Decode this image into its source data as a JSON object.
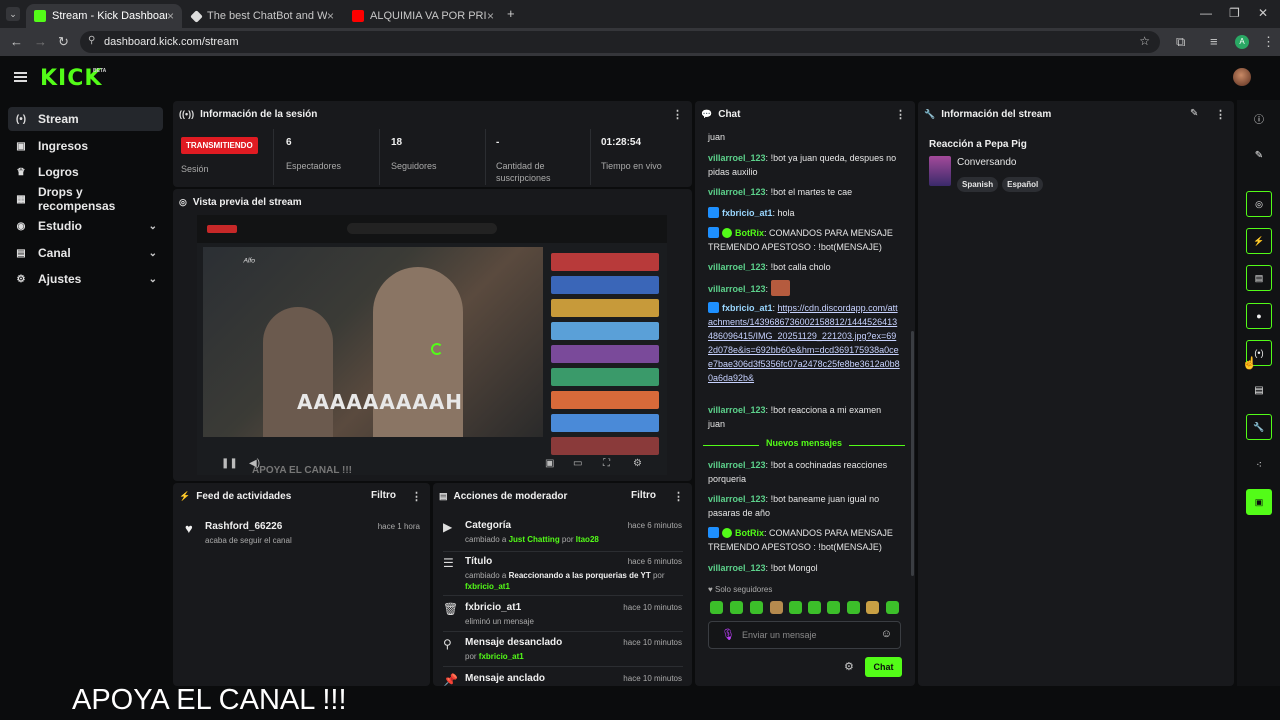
{
  "browser": {
    "tabs": [
      {
        "label": "Stream - Kick Dashboard",
        "active": true,
        "favicon_color": "#53fc18"
      },
      {
        "label": "The best ChatBot and Widgets",
        "active": false,
        "favicon_color": "#dddddd"
      },
      {
        "label": "ALQUIMIA VA POR PRIMERA V",
        "active": false,
        "favicon_color": "#ff0000"
      }
    ],
    "new_tab": "+",
    "url": "dashboard.kick.com/stream",
    "profile_initial": "A"
  },
  "header": {
    "logo": "KICK",
    "beta": "BETA"
  },
  "sidebar": {
    "items": [
      {
        "label": "Stream",
        "icon": "broadcast-icon",
        "glyph": "(•)",
        "active": true
      },
      {
        "label": "Ingresos",
        "icon": "money-icon",
        "glyph": "▣",
        "active": false
      },
      {
        "label": "Logros",
        "icon": "trophy-icon",
        "glyph": "♛",
        "active": false
      },
      {
        "label": "Drops y recompensas",
        "icon": "gift-icon",
        "glyph": "▦",
        "active": false
      },
      {
        "label": "Estudio",
        "icon": "studio-icon",
        "glyph": "◉",
        "active": false,
        "chevron": "⌄"
      },
      {
        "label": "Canal",
        "icon": "channel-icon",
        "glyph": "▤",
        "active": false,
        "chevron": "⌄"
      },
      {
        "label": "Ajustes",
        "icon": "settings-icon",
        "glyph": "⚙",
        "active": false,
        "chevron": "⌄"
      }
    ]
  },
  "session": {
    "title": "Información de la sesión",
    "status": "TRANSMITIENDO",
    "status_label": "Sesión",
    "stats": [
      {
        "value": "6",
        "label": "Espectadores"
      },
      {
        "value": "18",
        "label": "Seguidores"
      },
      {
        "value": "-",
        "label": "Cantidad de suscripciones"
      },
      {
        "value": "01:28:54",
        "label": "Tiempo en vivo"
      }
    ]
  },
  "preview": {
    "title": "Vista previa del stream",
    "overlay_text": "AAAAAAAAAH",
    "sub_text": "APOYA EL CANAL !!!"
  },
  "feed": {
    "title": "Feed de actividades",
    "filter": "Filtro",
    "items": [
      {
        "user": "Rashford_66226",
        "action": "acaba de seguir el canal",
        "time": "hace 1 hora"
      }
    ]
  },
  "mod": {
    "title": "Acciones de moderador",
    "filter": "Filtro",
    "items": [
      {
        "title": "Categoría",
        "time": "hace 6 minutos",
        "pre": "cambiado a ",
        "target": "Just Chatting",
        "mid": " por ",
        "by": "Itao28"
      },
      {
        "title": "Título",
        "time": "hace 6 minutos",
        "pre": "cambiado a ",
        "target": "Reaccionando a las porquerias de YT",
        "mid": " por ",
        "by": "fxbricio_at1"
      },
      {
        "title": "fxbricio_at1",
        "time": "hace 10 minutos",
        "pre": "eliminó un mensaje",
        "target": "",
        "mid": "",
        "by": ""
      },
      {
        "title": "Mensaje desanclado",
        "time": "hace 10 minutos",
        "pre": "por ",
        "target": "",
        "mid": "",
        "by": "fxbricio_at1"
      },
      {
        "title": "Mensaje anclado",
        "time": "hace 10 minutos",
        "pre": "",
        "target": "",
        "mid": "",
        "by": ""
      }
    ]
  },
  "chat": {
    "title": "Chat",
    "messages": [
      {
        "user": "",
        "text": "juan"
      },
      {
        "user": "villarroel_123",
        "text": "!bot ya juan queda, despues no pidas auxilio"
      },
      {
        "user": "villarroel_123",
        "text": "!bot el martes te cae"
      },
      {
        "user": "fxbricio_at1",
        "text": "hola"
      },
      {
        "user": "BotRix",
        "text": "COMANDOS PARA MENSAJE TREMENDO APESTOSO : !bot(MENSAJE)"
      },
      {
        "user": "villarroel_123",
        "text": "!bot calla cholo"
      },
      {
        "user": "villarroel_123",
        "text": ""
      },
      {
        "user": "fxbricio_at1",
        "text": "https://cdn.discordapp.com/attachments/1439686736002158812/1444526413486096415/IMG_20251129_221203.jpg?ex=692d078e&is=692bb60e&hm=dcd369175938a0cee7bae306d3f5356fc07a2478c25fe8be3612a0b80a6da92b&"
      },
      {
        "user": "villarroel_123",
        "text": "!bot reacciona a mi examen juan"
      },
      {
        "user": "villarroel_123",
        "text": "!bot a cochinadas reacciones porqueria"
      },
      {
        "user": "villarroel_123",
        "text": "!bot baneame juan igual no pasaras de año"
      },
      {
        "user": "BotRix",
        "text": "COMANDOS PARA MENSAJE TREMENDO APESTOSO : !bot(MENSAJE)"
      },
      {
        "user": "villarroel_123",
        "text": "!bot Mongol"
      }
    ],
    "new_messages": "Nuevos mensajes",
    "followers_only": "Solo seguidores",
    "input_placeholder": "Enviar un mensaje",
    "send": "Chat"
  },
  "stream_info": {
    "title": "Información del stream",
    "stream_title": "Reacción a Pepa Pig",
    "category": "Conversando",
    "tags": [
      "Spanish",
      "Español"
    ]
  },
  "overlay_caption": "APOYA EL CANAL !!!",
  "colors": {
    "brand": "#53fc18",
    "live": "#e01b22",
    "panel": "#18191c",
    "bg": "#0b0c0d"
  }
}
